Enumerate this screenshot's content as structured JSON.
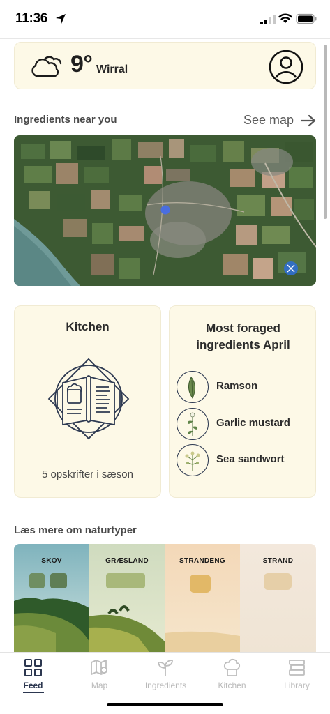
{
  "status_bar": {
    "time": "11:36",
    "icons": [
      "location-arrow-icon",
      "signal-icon",
      "wifi-icon",
      "battery-icon"
    ]
  },
  "weather": {
    "temperature": "9°",
    "location": "Wirral",
    "icon": "cloud-icon"
  },
  "profile": {
    "icon": "user-profile-icon"
  },
  "ingredients_near": {
    "title": "Ingredients near you",
    "see_map": "See map"
  },
  "kitchen": {
    "title": "Kitchen",
    "subtitle": "5 opskrifter i sæson"
  },
  "most_foraged": {
    "title": "Most foraged ingredients April",
    "items": [
      {
        "label": "Ramson",
        "icon": "ramson-leaf-icon"
      },
      {
        "label": "Garlic mustard",
        "icon": "garlic-mustard-icon"
      },
      {
        "label": "Sea sandwort",
        "icon": "sea-sandwort-icon"
      }
    ]
  },
  "nature_types": {
    "title": "Læs mere om naturtyper",
    "items": [
      {
        "label": "SKOV",
        "swatch": "#6f8e62"
      },
      {
        "label": "GRÆSLAND",
        "swatch": "#a8b87a"
      },
      {
        "label": "STRANDENG",
        "swatch": "#e2b867"
      },
      {
        "label": "STRAND",
        "swatch": "#e6cfa8"
      }
    ]
  },
  "tab_bar": {
    "tabs": [
      {
        "label": "Feed",
        "icon": "grid-icon",
        "active": true
      },
      {
        "label": "Map",
        "icon": "map-icon",
        "active": false
      },
      {
        "label": "Ingredients",
        "icon": "sprout-icon",
        "active": false
      },
      {
        "label": "Kitchen",
        "icon": "chef-hat-icon",
        "active": false
      },
      {
        "label": "Library",
        "icon": "books-icon",
        "active": false
      }
    ]
  },
  "colors": {
    "card_bg": "#fdf9e7",
    "accent_navy": "#2c3750",
    "text_dark": "#2b2b2b"
  }
}
